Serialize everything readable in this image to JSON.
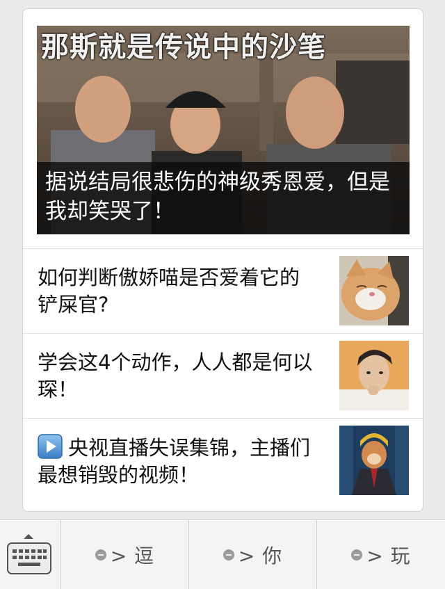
{
  "hero": {
    "overlay_text": "那斯就是传说中的沙笔",
    "caption": "据说结局很悲伤的神级秀恩爱，但是我却笑哭了！"
  },
  "articles": [
    {
      "title": "如何判断傲娇喵是否爱着它的铲屎官?",
      "thumb_icon": "cat-photo"
    },
    {
      "title": "学会这4个动作，人人都是何以琛！",
      "thumb_icon": "man-photo"
    },
    {
      "title": "央视直播失误集锦，主播们最想销毁的视频！",
      "thumb_icon": "monkey-anchor-photo",
      "prefix_icon": "play-icon"
    }
  ],
  "menu": {
    "keyboard_icon": "keyboard-icon",
    "items": [
      {
        "label": "> 逗"
      },
      {
        "label": "> 你"
      },
      {
        "label": "> 玩"
      }
    ]
  }
}
